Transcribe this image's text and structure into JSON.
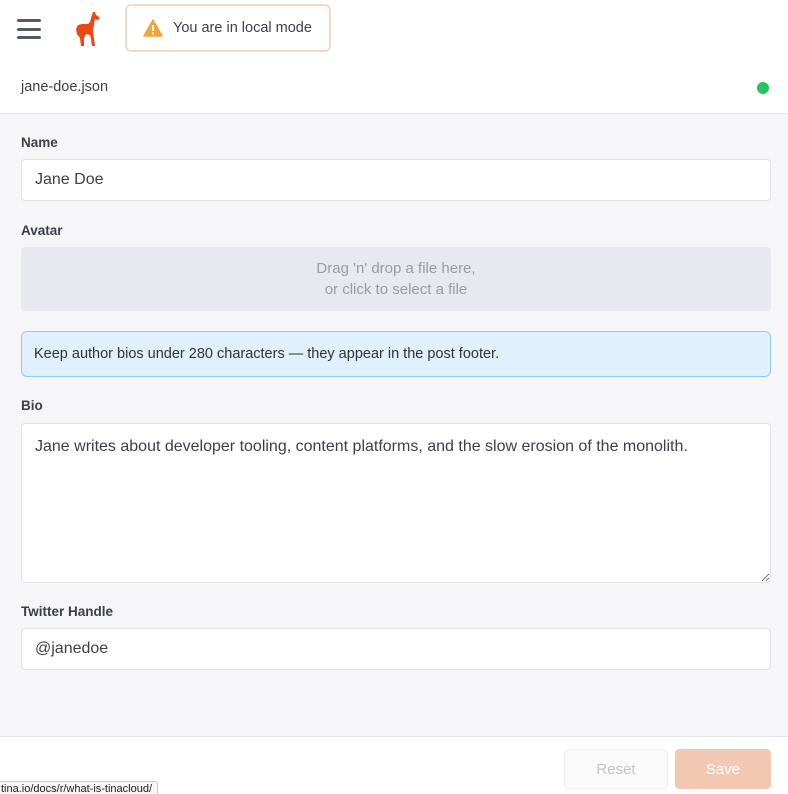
{
  "header": {
    "menu_icon": "hamburger-menu-icon",
    "logo_icon": "llama-logo-icon",
    "local_mode": {
      "icon": "warning-triangle-icon",
      "text": "You are in local mode"
    }
  },
  "file": {
    "name": "jane-doe.json",
    "status_color": "#22c55e"
  },
  "form": {
    "name": {
      "label": "Name",
      "value": "Jane Doe"
    },
    "avatar": {
      "label": "Avatar",
      "drop_line1": "Drag 'n' drop a file here,",
      "drop_line2": "or click to select a file"
    },
    "notice": "Keep author bios under 280 characters — they appear in the post footer.",
    "bio": {
      "label": "Bio",
      "value": "Jane writes about developer tooling, content platforms, and the slow erosion of the monolith."
    },
    "twitter": {
      "label": "Twitter Handle",
      "value": "@janedoe"
    }
  },
  "footer": {
    "reset_label": "Reset",
    "save_label": "Save"
  },
  "status_bar": {
    "url": "tina.io/docs/r/what-is-tinacloud/"
  },
  "colors": {
    "accent": "#ec4815",
    "save_disabled": "#f4c9b4",
    "info_bg": "#e1f0fd",
    "info_border": "#8ecbf4"
  }
}
